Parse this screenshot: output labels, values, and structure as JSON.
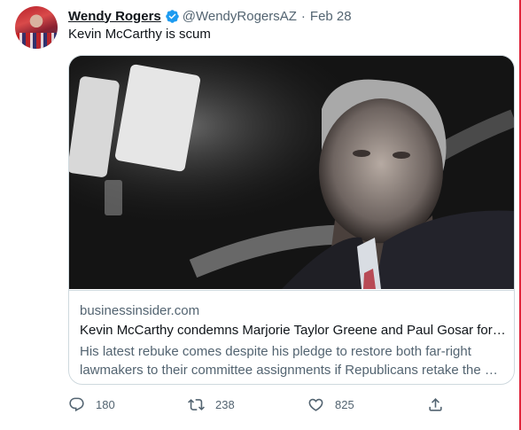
{
  "tweet": {
    "author_name": "Wendy Rogers",
    "handle": "@WendyRogersAZ",
    "separator": "·",
    "date": "Feb 28",
    "text": "Kevin McCarthy is scum"
  },
  "card": {
    "domain": "businessinsider.com",
    "title": "Kevin McCarthy condemns Marjorie Taylor Greene and Paul Gosar for …",
    "description": "His latest rebuke comes despite his pledge to restore both far-right lawmakers to their committee assignments if Republicans retake the …"
  },
  "actions": {
    "replies": "180",
    "retweets": "238",
    "likes": "825"
  },
  "icons": {
    "verified": "verified-badge-icon",
    "reply": "reply-icon",
    "retweet": "retweet-icon",
    "like": "heart-icon",
    "share": "share-icon"
  },
  "colors": {
    "verified": "#1d9bf0",
    "frame": "#e0243a",
    "secondary_text": "#536471"
  }
}
